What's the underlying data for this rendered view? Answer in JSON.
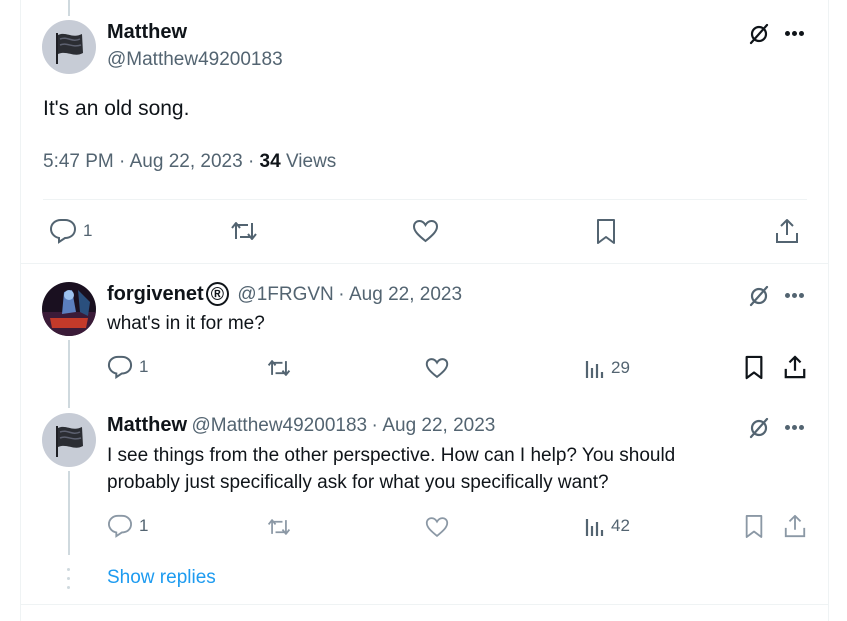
{
  "main_tweet": {
    "author_name": "Matthew",
    "author_handle": "@Matthew49200183",
    "text": "It's an old song.",
    "time": "5:47 PM",
    "date": "Aug 22, 2023",
    "views_count": "34",
    "views_label": "Views",
    "reply_count": "1"
  },
  "reply1": {
    "author_name": "forgivenet",
    "author_badge": "®",
    "author_handle": "@1FRGVN",
    "date": "Aug 22, 2023",
    "text": "what's in it for me?",
    "reply_count": "1",
    "views_count": "29"
  },
  "reply2": {
    "author_name": "Matthew",
    "author_handle": "@Matthew49200183",
    "date": "Aug 22, 2023",
    "text_line1": "I see things from the other perspective.  How can I help?  You should",
    "text_line2": "probably just specifically ask for what you specifically want?",
    "reply_count": "1",
    "views_count": "42"
  },
  "show_replies_label": "Show replies",
  "sep": "·",
  "colors": {
    "accent": "#1d9bf0",
    "muted": "#536471",
    "text": "#0f1419",
    "border": "#eff3f4"
  }
}
